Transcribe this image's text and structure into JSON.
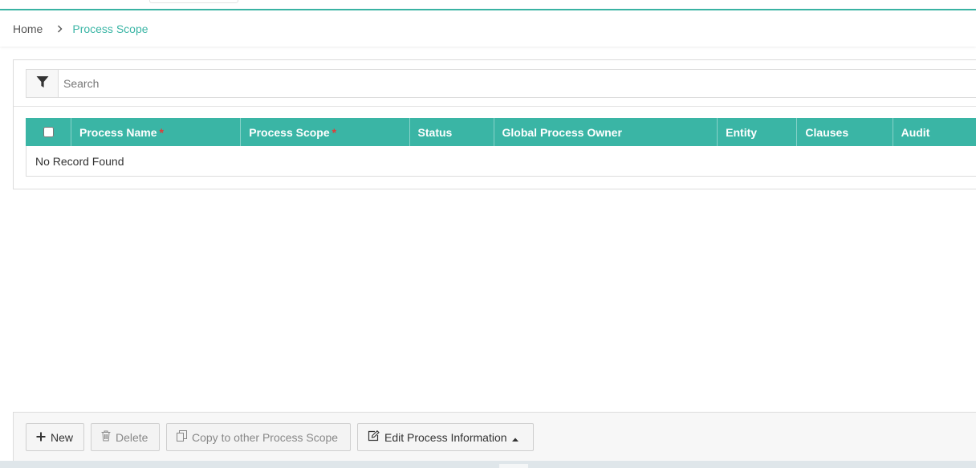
{
  "breadcrumb": {
    "home": "Home",
    "current": "Process Scope"
  },
  "search": {
    "placeholder": "Search",
    "value": ""
  },
  "grid": {
    "columns": [
      {
        "label": "Process Name",
        "required": "*"
      },
      {
        "label": "Process Scope",
        "required": "*"
      },
      {
        "label": "Status"
      },
      {
        "label": "Global Process Owner"
      },
      {
        "label": "Entity"
      },
      {
        "label": "Clauses"
      },
      {
        "label": "Audit"
      }
    ],
    "empty_message": "No Record Found"
  },
  "toolbar": {
    "new_label": "New",
    "delete_label": "Delete",
    "copy_label": "Copy to other Process Scope",
    "edit_label": "Edit Process Information"
  },
  "colors": {
    "accent": "#3ab5a5",
    "required": "#e53935"
  },
  "icons": {
    "breadcrumb_separator": "chevron-right-icon",
    "filter": "filter-icon",
    "new": "plus-icon",
    "delete": "trash-icon",
    "copy": "copy-icon",
    "edit": "edit-icon",
    "edit_caret": "caret-up-icon"
  }
}
